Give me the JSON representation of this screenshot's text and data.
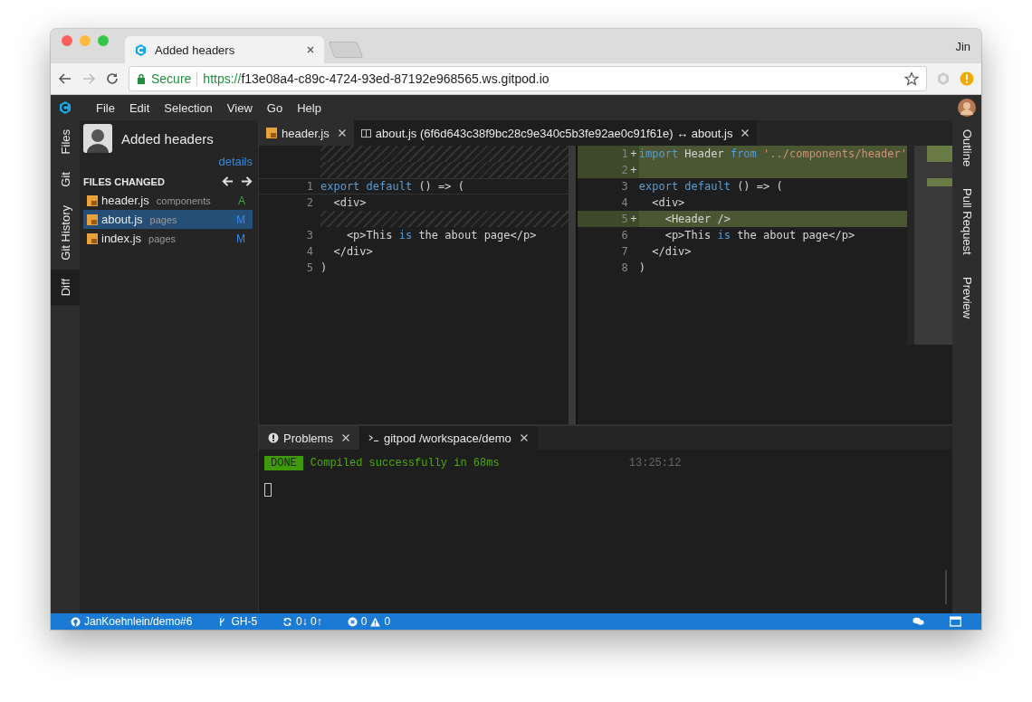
{
  "browser": {
    "tab_title": "Added headers",
    "user": "Jin",
    "secure_label": "Secure",
    "url_scheme": "https://",
    "url_rest": "f13e08a4-c89c-4724-93ed-87192e968565.ws.gitpod.io"
  },
  "menu": [
    "File",
    "Edit",
    "Selection",
    "View",
    "Go",
    "Help"
  ],
  "left_bar": [
    {
      "label": "Files",
      "selected": false
    },
    {
      "label": "Git",
      "selected": false
    },
    {
      "label": "Git History",
      "selected": false
    },
    {
      "label": "Diff",
      "selected": true
    }
  ],
  "right_bar": [
    {
      "label": "Outline"
    },
    {
      "label": "Pull Request"
    },
    {
      "label": "Preview"
    }
  ],
  "sidebar": {
    "commit_title": "Added headers",
    "details_link": "details",
    "section_title": "FILES CHANGED",
    "files": [
      {
        "name": "header.js",
        "folder": "components",
        "status": "A",
        "color": "#3fa33f",
        "selected": false
      },
      {
        "name": "about.js",
        "folder": "pages",
        "status": "M",
        "color": "#2f8ae5",
        "selected": true
      },
      {
        "name": "index.js",
        "folder": "pages",
        "status": "M",
        "color": "#2f8ae5",
        "selected": false
      }
    ]
  },
  "editor_tabs": [
    {
      "kind": "file",
      "label": "header.js",
      "selected": false
    },
    {
      "kind": "diff",
      "label": "about.js (6f6d643c38f9bc28c9e340c5b3fe92ae0c91f61e) ↔ about.js",
      "selected": true
    }
  ],
  "diff": {
    "left": [
      {
        "kind": "placeholder"
      },
      {
        "kind": "placeholder"
      },
      {
        "kind": "line",
        "number": "1",
        "current": true,
        "tokens": [
          {
            "kind": "keyword",
            "text": "export default"
          },
          {
            "kind": "plain",
            "text": " () => ("
          }
        ]
      },
      {
        "kind": "line",
        "number": "2",
        "current": false,
        "tokens": [
          {
            "kind": "plain",
            "text": "  <div>"
          }
        ]
      },
      {
        "kind": "placeholder"
      },
      {
        "kind": "line",
        "number": "3",
        "current": false,
        "tokens": [
          {
            "kind": "plain",
            "text": "    <p>This "
          },
          {
            "kind": "keyword",
            "text": "is"
          },
          {
            "kind": "plain",
            "text": " the about page</p>"
          }
        ]
      },
      {
        "kind": "line",
        "number": "4",
        "current": false,
        "tokens": [
          {
            "kind": "plain",
            "text": "  </div>"
          }
        ]
      },
      {
        "kind": "line",
        "number": "5",
        "current": false,
        "tokens": [
          {
            "kind": "plain",
            "text": ")"
          }
        ]
      }
    ],
    "right": [
      {
        "number": "1",
        "added": true,
        "mark": "+",
        "tokens": [
          {
            "kind": "keyword",
            "text": "import"
          },
          {
            "kind": "plain",
            "text": " Header "
          },
          {
            "kind": "keyword",
            "text": "from"
          },
          {
            "kind": "string",
            "text": " '../components/header'"
          }
        ]
      },
      {
        "number": "2",
        "added": true,
        "mark": "+"
      },
      {
        "number": "3",
        "added": false,
        "tokens": [
          {
            "kind": "keyword",
            "text": "export default"
          },
          {
            "kind": "plain",
            "text": " () => ("
          }
        ]
      },
      {
        "number": "4",
        "added": false,
        "tokens": [
          {
            "kind": "plain",
            "text": "  <div>"
          }
        ]
      },
      {
        "number": "5",
        "added": true,
        "mark": "+",
        "tokens": [
          {
            "kind": "plain",
            "text": "    <Header />"
          }
        ]
      },
      {
        "number": "6",
        "added": false,
        "tokens": [
          {
            "kind": "plain",
            "text": "    <p>This "
          },
          {
            "kind": "keyword",
            "text": "is"
          },
          {
            "kind": "plain",
            "text": " the about page</p>"
          }
        ]
      },
      {
        "number": "7",
        "added": false,
        "tokens": [
          {
            "kind": "plain",
            "text": "  </div>"
          }
        ]
      },
      {
        "number": "8",
        "added": false,
        "tokens": [
          {
            "kind": "plain",
            "text": ")"
          }
        ]
      }
    ]
  },
  "panel_tabs": [
    {
      "kind": "problems",
      "label": "Problems",
      "selected": false
    },
    {
      "kind": "terminal",
      "label": "gitpod /workspace/demo",
      "selected": true
    }
  ],
  "terminal": {
    "badge": "DONE",
    "message": "Compiled successfully in 68ms",
    "time": "13:25:12"
  },
  "status_bar": {
    "repo": "JanKoehnlein/demo#6",
    "branch": "GH-5",
    "sync": "0↓ 0↑",
    "errors": "0",
    "warnings": "0"
  }
}
